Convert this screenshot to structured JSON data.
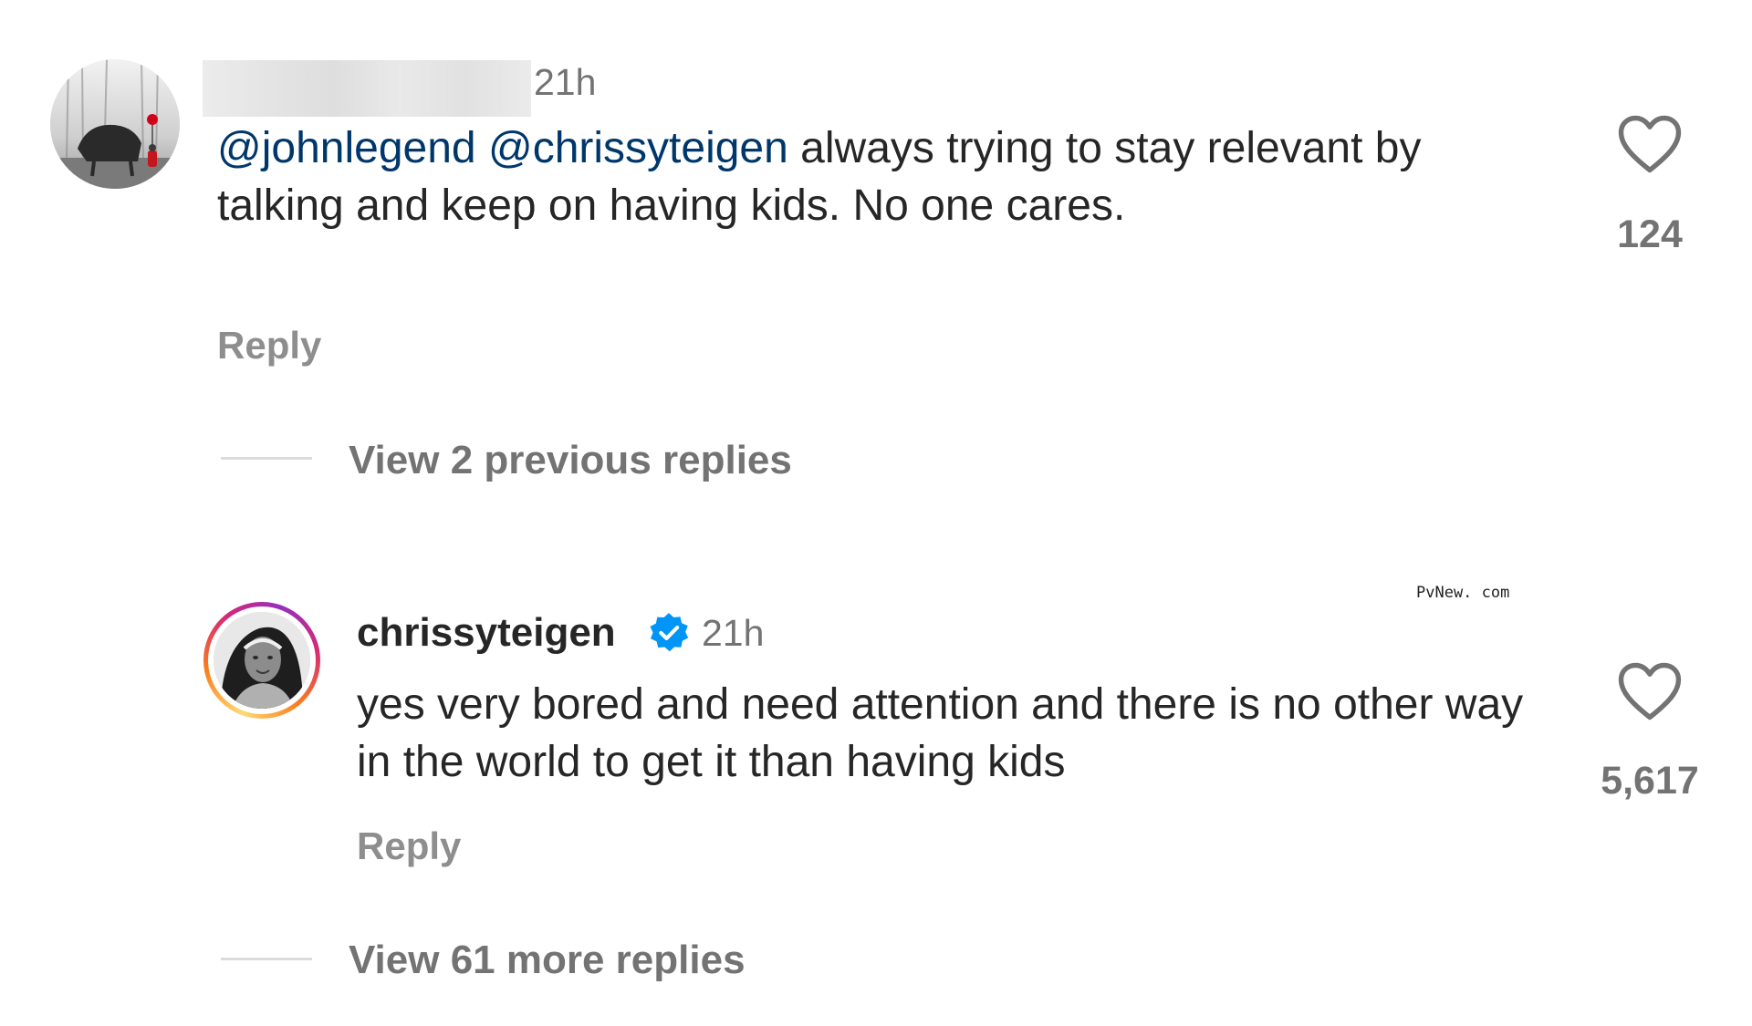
{
  "comments": [
    {
      "time": "21h",
      "mentions": [
        "@johnlegend",
        "@chrissyteigen"
      ],
      "text": " always trying to stay relevant by talking and keep on having kids. No one cares.",
      "reply_label": "Reply",
      "likes": "124",
      "view_replies_label": "View 2 previous replies"
    },
    {
      "username": "chrissyteigen",
      "verified": true,
      "time": "21h",
      "text": "yes very bored and need attention and there is no other way in the world to get it than having kids",
      "reply_label": "Reply",
      "likes": "5,617",
      "view_replies_label": "View 61 more replies"
    }
  ],
  "watermark": "PvNew. com",
  "colors": {
    "mention": "#00376b",
    "secondary_text": "#737373",
    "primary_text": "#262626",
    "verified_blue": "#0095f6",
    "divider": "#dbdbdb"
  },
  "icons": {
    "like": "heart-outline-icon",
    "verified": "verified-badge-icon"
  }
}
